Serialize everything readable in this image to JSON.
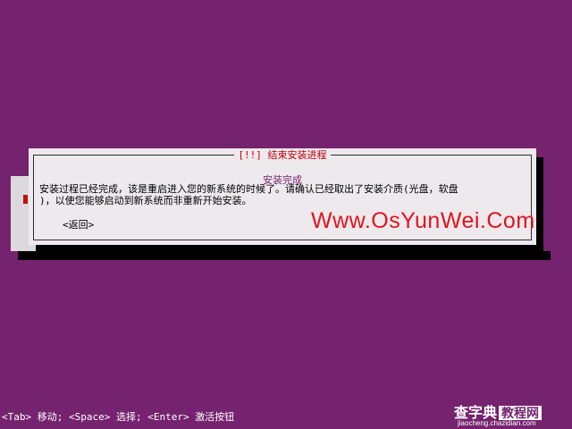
{
  "colors": {
    "desktop_bg": "#75226f",
    "dialog_bg": "#ede9ed",
    "title_text": "#c0000b",
    "subtitle_text": "#75226f",
    "watermark_text": "#e0141c"
  },
  "dialog": {
    "title": "[!!] 结束安装进程",
    "subtitle": "安装完成",
    "message": "安装过程已经完成，该是重启进入您的新系统的时候了。请确认已经取出了安装介质(光盘，软盘\n)，以使您能够启动到新系统而非重新开始安装。",
    "back_button": "<返回>"
  },
  "watermark": {
    "text": "Www.OsYunWei.Com"
  },
  "status_bar": {
    "text": "<Tab> 移动; <Space> 选择; <Enter> 激活按钮"
  },
  "logo": {
    "main": "查字典",
    "accent": "教程网",
    "url": "jiaocheng.chazidian.com"
  }
}
